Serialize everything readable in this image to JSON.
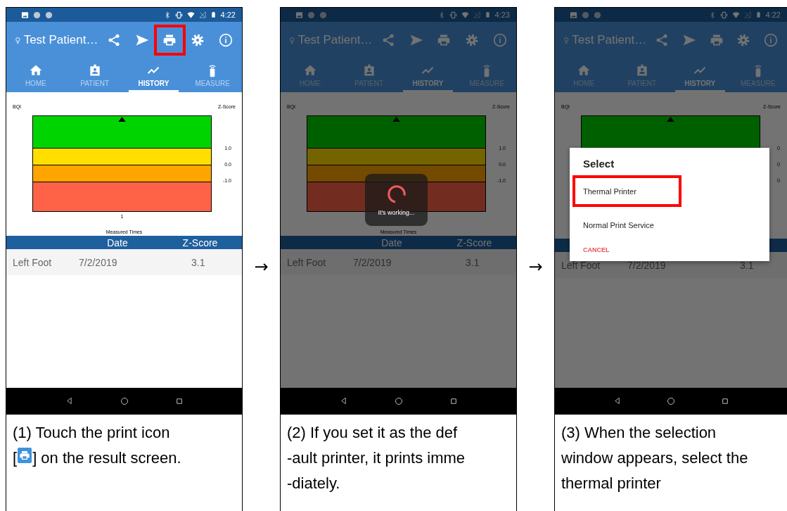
{
  "panels": [
    {
      "phone": {
        "status_time": "4:22",
        "title": "Test Patient…",
        "actions": [
          {
            "kind": "share",
            "highlighted": false
          },
          {
            "kind": "send",
            "highlighted": false
          },
          {
            "kind": "print",
            "highlighted": true
          },
          {
            "kind": "settings",
            "highlighted": false
          },
          {
            "kind": "info",
            "highlighted": false
          }
        ],
        "tabs": [
          {
            "kind": "home",
            "label": "HOME",
            "selected": false
          },
          {
            "kind": "patient",
            "label": "PATIENT",
            "selected": false
          },
          {
            "kind": "history",
            "label": "HISTORY",
            "selected": true
          },
          {
            "kind": "measure",
            "label": "MEASURE",
            "selected": false
          }
        ],
        "chart": {
          "left_label": "BQI",
          "right_label": "Z-Score",
          "ticks": [
            "1.0",
            "0.0",
            "-1.0"
          ],
          "x_tick": "1",
          "x_label": "Measured Times"
        },
        "table": {
          "columns": [
            "",
            "Date",
            "Z-Score"
          ],
          "rows": [
            [
              "Left Foot",
              "7/2/2019",
              "3.1"
            ]
          ]
        }
      },
      "caption": [
        [
          {
            "kind": "text",
            "text": "(1) Touch the print icon"
          }
        ],
        [
          {
            "kind": "text",
            "text": "["
          },
          {
            "kind": "icon"
          },
          {
            "kind": "text",
            "text": "] on the result screen."
          }
        ]
      ]
    },
    {
      "phone": {
        "status_time": "4:23",
        "title": "Test Patient…",
        "actions": [
          {
            "kind": "share",
            "highlighted": false
          },
          {
            "kind": "send",
            "highlighted": false
          },
          {
            "kind": "print",
            "highlighted": false
          },
          {
            "kind": "settings",
            "highlighted": false
          },
          {
            "kind": "info",
            "highlighted": false
          }
        ],
        "tabs": [
          {
            "kind": "home",
            "label": "HOME",
            "selected": false
          },
          {
            "kind": "patient",
            "label": "PATIENT",
            "selected": false
          },
          {
            "kind": "history",
            "label": "HISTORY",
            "selected": true
          },
          {
            "kind": "measure",
            "label": "MEASURE",
            "selected": false
          }
        ],
        "chart": {
          "left_label": "BQI",
          "right_label": "Z-Score",
          "ticks": [
            "1.0",
            "0.0",
            "-1.0"
          ],
          "x_label": "Measured Times"
        },
        "table": {
          "columns": [
            "",
            "Date",
            "Z-Score"
          ],
          "rows": [
            [
              "Left Foot",
              "7/2/2019",
              "3.1"
            ]
          ]
        },
        "overlay": {
          "kind": "progress",
          "message": "It's working..."
        }
      },
      "caption": [
        [
          {
            "kind": "text",
            "text": "(2) If you set it as the def"
          }
        ],
        [
          {
            "kind": "text",
            "text": "-ault printer, it prints imme"
          }
        ],
        [
          {
            "kind": "text",
            "text": "-diately."
          }
        ]
      ]
    },
    {
      "phone": {
        "status_time": "4:22",
        "title": "Test Patient…",
        "actions": [
          {
            "kind": "share",
            "highlighted": false
          },
          {
            "kind": "send",
            "highlighted": false
          },
          {
            "kind": "print",
            "highlighted": false
          },
          {
            "kind": "settings",
            "highlighted": false
          },
          {
            "kind": "info",
            "highlighted": false
          }
        ],
        "tabs": [
          {
            "kind": "home",
            "label": "HOME",
            "selected": false
          },
          {
            "kind": "patient",
            "label": "PATIENT",
            "selected": false
          },
          {
            "kind": "history",
            "label": "HISTORY",
            "selected": true
          },
          {
            "kind": "measure",
            "label": "MEASURE",
            "selected": false
          }
        ],
        "chart": {
          "left_label": "BQI",
          "right_label": "Z-Score",
          "ticks": [
            "0",
            "0",
            "0"
          ]
        },
        "table": {
          "rows": [
            [
              "Left Foot",
              "7/2/2019",
              "3.1"
            ]
          ]
        },
        "overlay": {
          "kind": "dialog",
          "title": "Select",
          "options": [
            {
              "label": "Thermal Printer",
              "highlighted": true
            },
            {
              "label": "Normal Print Service",
              "highlighted": false
            }
          ],
          "cancel": "CANCEL"
        }
      },
      "caption": [
        [
          {
            "kind": "text",
            "text": "(3) When the selection"
          }
        ],
        [
          {
            "kind": "text",
            "text": "window appears, select the"
          }
        ],
        [
          {
            "kind": "text",
            "text": "thermal printer"
          }
        ]
      ]
    }
  ],
  "arrows": [
    "→",
    "→"
  ]
}
